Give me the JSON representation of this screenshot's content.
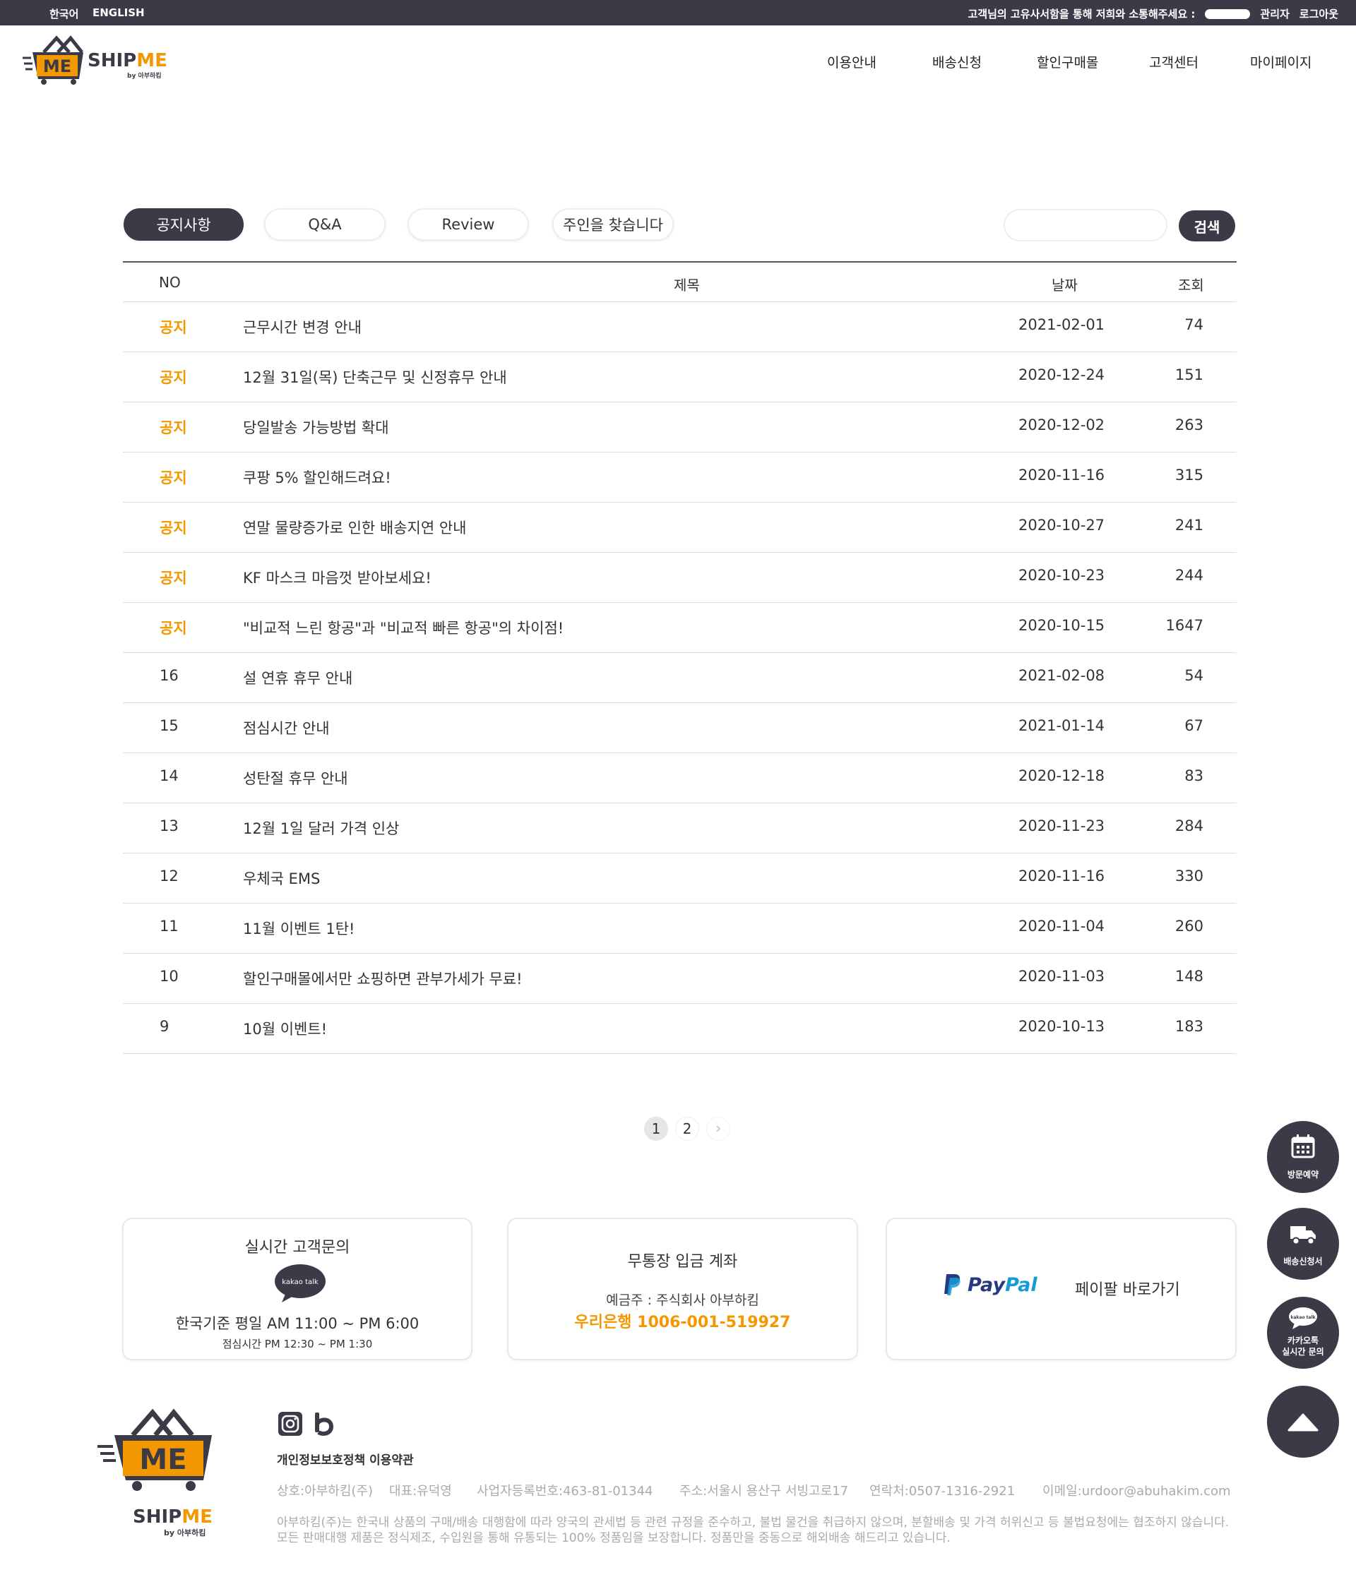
{
  "topbar": {
    "lang_ko": "한국어",
    "lang_en": "ENGLISH",
    "notice": "고객님의 고유사서함을 통해 저희와 소통해주세요 :",
    "admin": "관리자",
    "logout": "로그아웃"
  },
  "brand": {
    "logo_me": "ME",
    "logo_ship": "SHIP",
    "logo_me2": "ME",
    "logo_by": "by 아부하킴"
  },
  "nav": [
    "이용안내",
    "배송신청",
    "할인구매몰",
    "고객센터",
    "마이페이지"
  ],
  "tabs": [
    "공지사항",
    "Q&A",
    "Review",
    "주인을 찾습니다"
  ],
  "search": {
    "placeholder": "",
    "button": "검색"
  },
  "table": {
    "headers": {
      "no": "NO",
      "title": "제목",
      "date": "날짜",
      "views": "조회"
    },
    "rows": [
      {
        "no": "공지",
        "title": "근무시간 변경 안내",
        "date": "2021-02-01",
        "views": "74"
      },
      {
        "no": "공지",
        "title": "12월 31일(목) 단축근무 및 신정휴무 안내",
        "date": "2020-12-24",
        "views": "151"
      },
      {
        "no": "공지",
        "title": "당일발송 가능방법 확대",
        "date": "2020-12-02",
        "views": "263"
      },
      {
        "no": "공지",
        "title": "쿠팡 5% 할인해드려요!",
        "date": "2020-11-16",
        "views": "315"
      },
      {
        "no": "공지",
        "title": "연말 물량증가로 인한 배송지연 안내",
        "date": "2020-10-27",
        "views": "241"
      },
      {
        "no": "공지",
        "title": "KF 마스크 마음껏 받아보세요!",
        "date": "2020-10-23",
        "views": "244"
      },
      {
        "no": "공지",
        "title": "\"비교적 느린 항공\"과 \"비교적 빠른 항공\"의 차이점!",
        "date": "2020-10-15",
        "views": "1647"
      },
      {
        "no": "16",
        "title": "설 연휴 휴무 안내",
        "date": "2021-02-08",
        "views": "54"
      },
      {
        "no": "15",
        "title": "점심시간 안내",
        "date": "2021-01-14",
        "views": "67"
      },
      {
        "no": "14",
        "title": "성탄절 휴무 안내",
        "date": "2020-12-18",
        "views": "83"
      },
      {
        "no": "13",
        "title": "12월 1일 달러 가격 인상",
        "date": "2020-11-23",
        "views": "284"
      },
      {
        "no": "12",
        "title": "우체국 EMS",
        "date": "2020-11-16",
        "views": "330"
      },
      {
        "no": "11",
        "title": "11월 이벤트 1탄!",
        "date": "2020-11-04",
        "views": "260"
      },
      {
        "no": "10",
        "title": "할인구매몰에서만 쇼핑하면 관부가세가 무료!",
        "date": "2020-11-03",
        "views": "148"
      },
      {
        "no": "9",
        "title": "10월 이벤트!",
        "date": "2020-10-13",
        "views": "183"
      }
    ]
  },
  "pagination": {
    "pages": [
      "1",
      "2"
    ],
    "current": "1",
    "next_icon": "chevron-right-icon"
  },
  "support": {
    "title": "실시간 고객문의",
    "kakao": "kakao talk",
    "hours": "한국기준 평일 AM 11:00 ~ PM 6:00",
    "lunch": "점심시간 PM 12:30 ~ PM 1:30"
  },
  "bank": {
    "title": "무통장 입금 계좌",
    "holder": "예금주 : 주식회사 아부하킴",
    "account": "우리은행 1006-001-519927"
  },
  "paypal": {
    "logo_pay": "Pay",
    "logo_pal": "Pal",
    "label": "페이팔 바로가기"
  },
  "fabs": {
    "visit": "방문예약",
    "shipping": "배송신청서",
    "kakao_small": "kakao talk",
    "kakao_line1": "카카오톡",
    "kakao_line2": "실시간 문의"
  },
  "footer": {
    "policy": "개인정보보호정책 이용약관",
    "company": "상호:아부하킴(주)",
    "ceo": "대표:유덕영",
    "bizno": "사업자등록번호:463-81-01344",
    "address": "주소:서울시 용산구 서빙고로17",
    "phone": "연락처:0507-1316-2921",
    "email": "이메일:urdoor@abuhakim.com",
    "disclaimer1": "아부하킴(주)는 한국내 상품의 구매/배송 대행함에 따라 양국의 관세법 등 관련 규정을 준수하고, 불법 물건을 취급하지 않으며, 분할배송 및 가격 허위신고 등 불법요청에는 협조하지 않습니다.",
    "disclaimer2": "모든 판매대행 제품은 정식제조, 수입원을 통해 유통되는 100% 정품임을 보장합니다. 정품만을 중동으로 해외배송 해드리고 있습니다."
  },
  "colors": {
    "dark": "#3a3b47",
    "accent": "#f39800",
    "paypal_dark": "#253b80",
    "paypal_light": "#179bd7"
  }
}
